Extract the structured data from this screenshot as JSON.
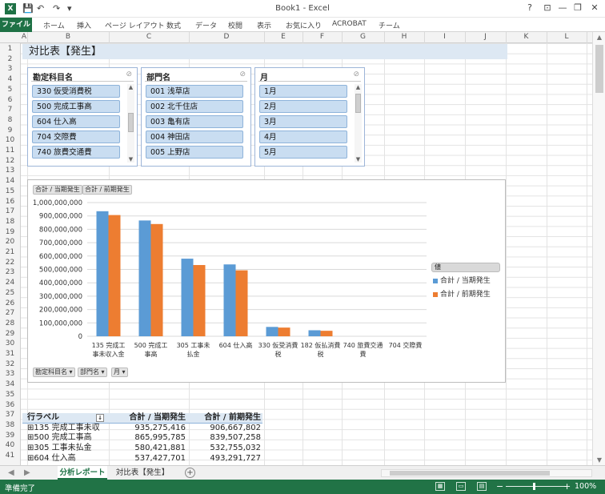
{
  "window": {
    "title": "Book1 - Excel",
    "help": "?",
    "minimize": "—",
    "restore": "❐",
    "close": "✕"
  },
  "ribbon": {
    "tabs": [
      "ファイル",
      "ホーム",
      "挿入",
      "ページ レイアウト",
      "数式",
      "データ",
      "校閲",
      "表示",
      "お気に入り",
      "ACROBAT",
      "チーム"
    ]
  },
  "columns": [
    "A",
    "B",
    "C",
    "D",
    "E",
    "F",
    "G",
    "H",
    "I",
    "J",
    "K",
    "L"
  ],
  "rows": [
    "1",
    "2",
    "3",
    "4",
    "5",
    "6",
    "7",
    "8",
    "9",
    "10",
    "11",
    "12",
    "13",
    "14",
    "15",
    "16",
    "17",
    "18",
    "19",
    "20",
    "21",
    "22",
    "23",
    "24",
    "25",
    "26",
    "27",
    "28",
    "29",
    "30",
    "31",
    "32",
    "33",
    "34",
    "35",
    "36",
    "37",
    "38",
    "39",
    "40",
    "41"
  ],
  "report_title": "対比表【発生】",
  "slicers": [
    {
      "title": "勘定科目名",
      "items": [
        "330 仮受消費税",
        "500 完成工事高",
        "604 仕入高",
        "704 交際費",
        "740 旅費交通費"
      ]
    },
    {
      "title": "部門名",
      "items": [
        "001 浅草店",
        "002 北千住店",
        "003 亀有店",
        "004 神田店",
        "005 上野店"
      ]
    },
    {
      "title": "月",
      "items": [
        "1月",
        "2月",
        "3月",
        "4月",
        "5月"
      ]
    }
  ],
  "chart": {
    "value_buttons": [
      "合計 / 当期発生",
      "合計 / 前期発生"
    ],
    "axis_buttons": [
      "勘定科目名 ▾",
      "部門名 ▾",
      "月 ▾"
    ],
    "legend_header": "値",
    "colors": {
      "current": "#5b9bd5",
      "previous": "#ed7d31"
    }
  },
  "chart_data": {
    "type": "bar",
    "categories": [
      "135 完成工事未収入金",
      "500 完成工事高",
      "305 工事未払金",
      "604 仕入高",
      "330 仮受消費税",
      "182 仮払消費税",
      "740 旅費交通費",
      "704 交際費"
    ],
    "series": [
      {
        "name": "合計 / 当期発生",
        "values": [
          935275416,
          865995785,
          580421881,
          537427701,
          70000000,
          45000000,
          0,
          0
        ]
      },
      {
        "name": "合計 / 前期発生",
        "values": [
          906667802,
          839507258,
          532755032,
          493291727,
          65000000,
          41000000,
          0,
          0
        ]
      }
    ],
    "ylim": [
      0,
      1000000000
    ],
    "yticks": [
      "1,000,000,000",
      "900,000,000",
      "800,000,000",
      "700,000,000",
      "600,000,000",
      "500,000,000",
      "400,000,000",
      "300,000,000",
      "200,000,000",
      "100,000,000",
      "0"
    ],
    "xtick_lines": [
      [
        "135 完成工",
        "事未収入金"
      ],
      [
        "500 完成工",
        "事高"
      ],
      [
        "305 工事未",
        "払金"
      ],
      [
        "604 仕入高"
      ],
      [
        "330 仮受消費",
        "税"
      ],
      [
        "182 仮払消費",
        "税"
      ],
      [
        "740 旅費交通",
        "費"
      ],
      [
        "704 交際費"
      ]
    ],
    "legend": "right",
    "grid": true
  },
  "pivot": {
    "headers": [
      "行ラベル",
      "合計 / 当期発生",
      "合計 / 前期発生"
    ],
    "filter_icon": "↓",
    "rows": [
      [
        "⊞135 完成工事未収",
        "935,275,416",
        "906,667,802"
      ],
      [
        "⊞500 完成工事高",
        "865,995,785",
        "839,507,258"
      ],
      [
        "⊞305 工事未払金",
        "580,421,881",
        "532,755,032"
      ],
      [
        "⊞604 仕入高",
        "537,427,701",
        "493,291,727"
      ]
    ]
  },
  "sheet_tabs": [
    "分析レポート",
    "対比表【発生】"
  ],
  "sheet_nav": [
    "◀",
    "▶"
  ],
  "add_sheet": "+",
  "status": {
    "text": "準備完了",
    "zoom_minus": "−",
    "zoom_plus": "+",
    "zoom": "100%"
  }
}
